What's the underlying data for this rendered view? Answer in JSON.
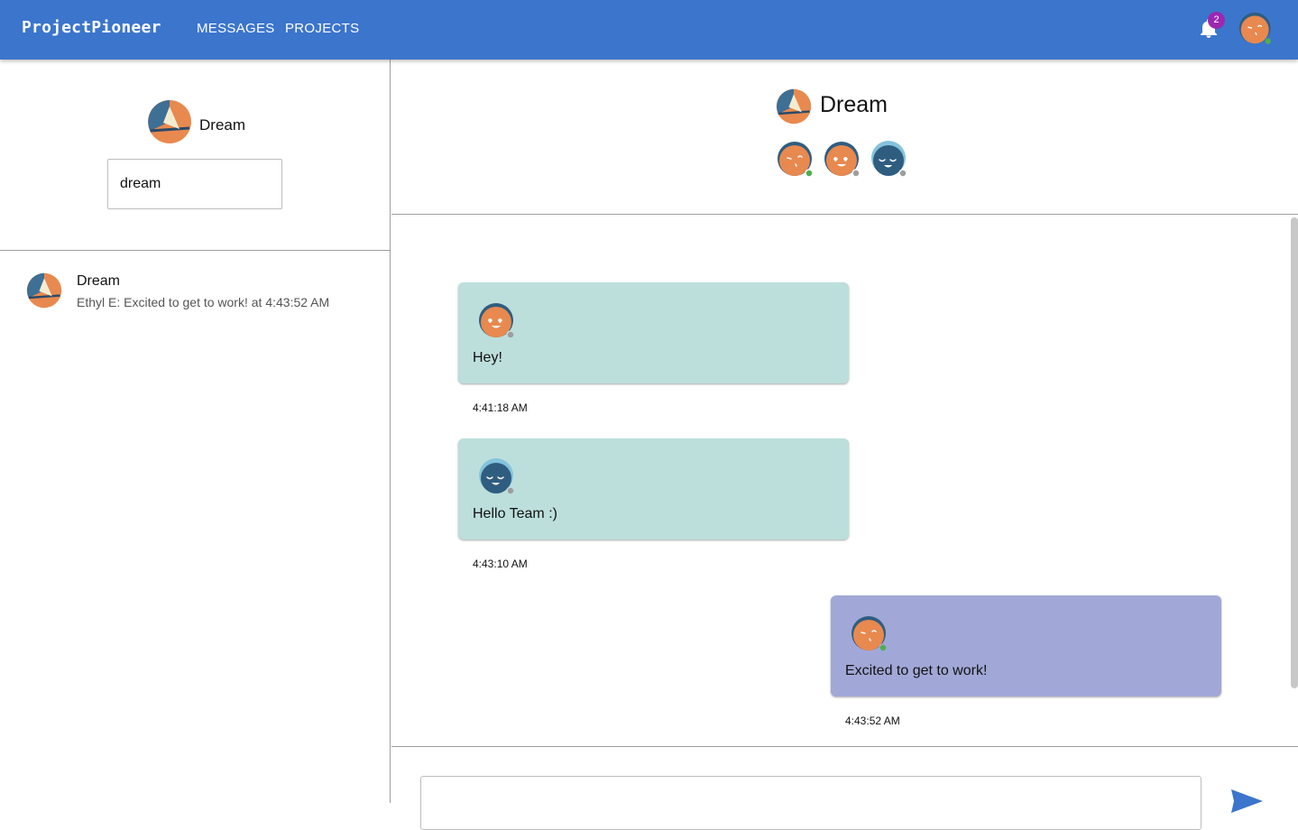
{
  "app": {
    "brand": "ProjectPioneer",
    "nav": [
      {
        "label": "MESSAGES"
      },
      {
        "label": "PROJECTS"
      }
    ],
    "notifications_count": "2"
  },
  "sidebar": {
    "project_name": "Dream",
    "search_value": "dream",
    "conversations": [
      {
        "name": "Dream",
        "preview": "Ethyl E: Excited to get to work! at 4:43:52 AM"
      }
    ]
  },
  "chat": {
    "title": "Dream",
    "members": [
      {
        "avatar": "wink-avatar-icon",
        "status": "online"
      },
      {
        "avatar": "heart-eyes-avatar-icon",
        "status": "offline"
      },
      {
        "avatar": "smiling-avatar-icon",
        "status": "offline"
      }
    ],
    "messages": [
      {
        "text": "Hey!",
        "time": "4:41:18 AM",
        "avatar": "heart-eyes-avatar-icon",
        "side": "left"
      },
      {
        "text": "Hello Team :)",
        "time": "4:43:10 AM",
        "avatar": "smiling-avatar-icon",
        "side": "left"
      },
      {
        "text": "Excited to get to work!",
        "time": "4:43:52 AM",
        "avatar": "wink-avatar-icon",
        "side": "right"
      }
    ]
  },
  "colors": {
    "topbar": "#3b75cc",
    "badge": "#9c27b0",
    "bubble_others": "#bcdfdc",
    "bubble_self": "#a1a8d7",
    "avatar_orange": "#e8894f",
    "avatar_navy": "#2f5d80",
    "avatar_sky": "#84c3dc",
    "status_online": "#4caf50",
    "status_offline": "#9e9e9e"
  }
}
